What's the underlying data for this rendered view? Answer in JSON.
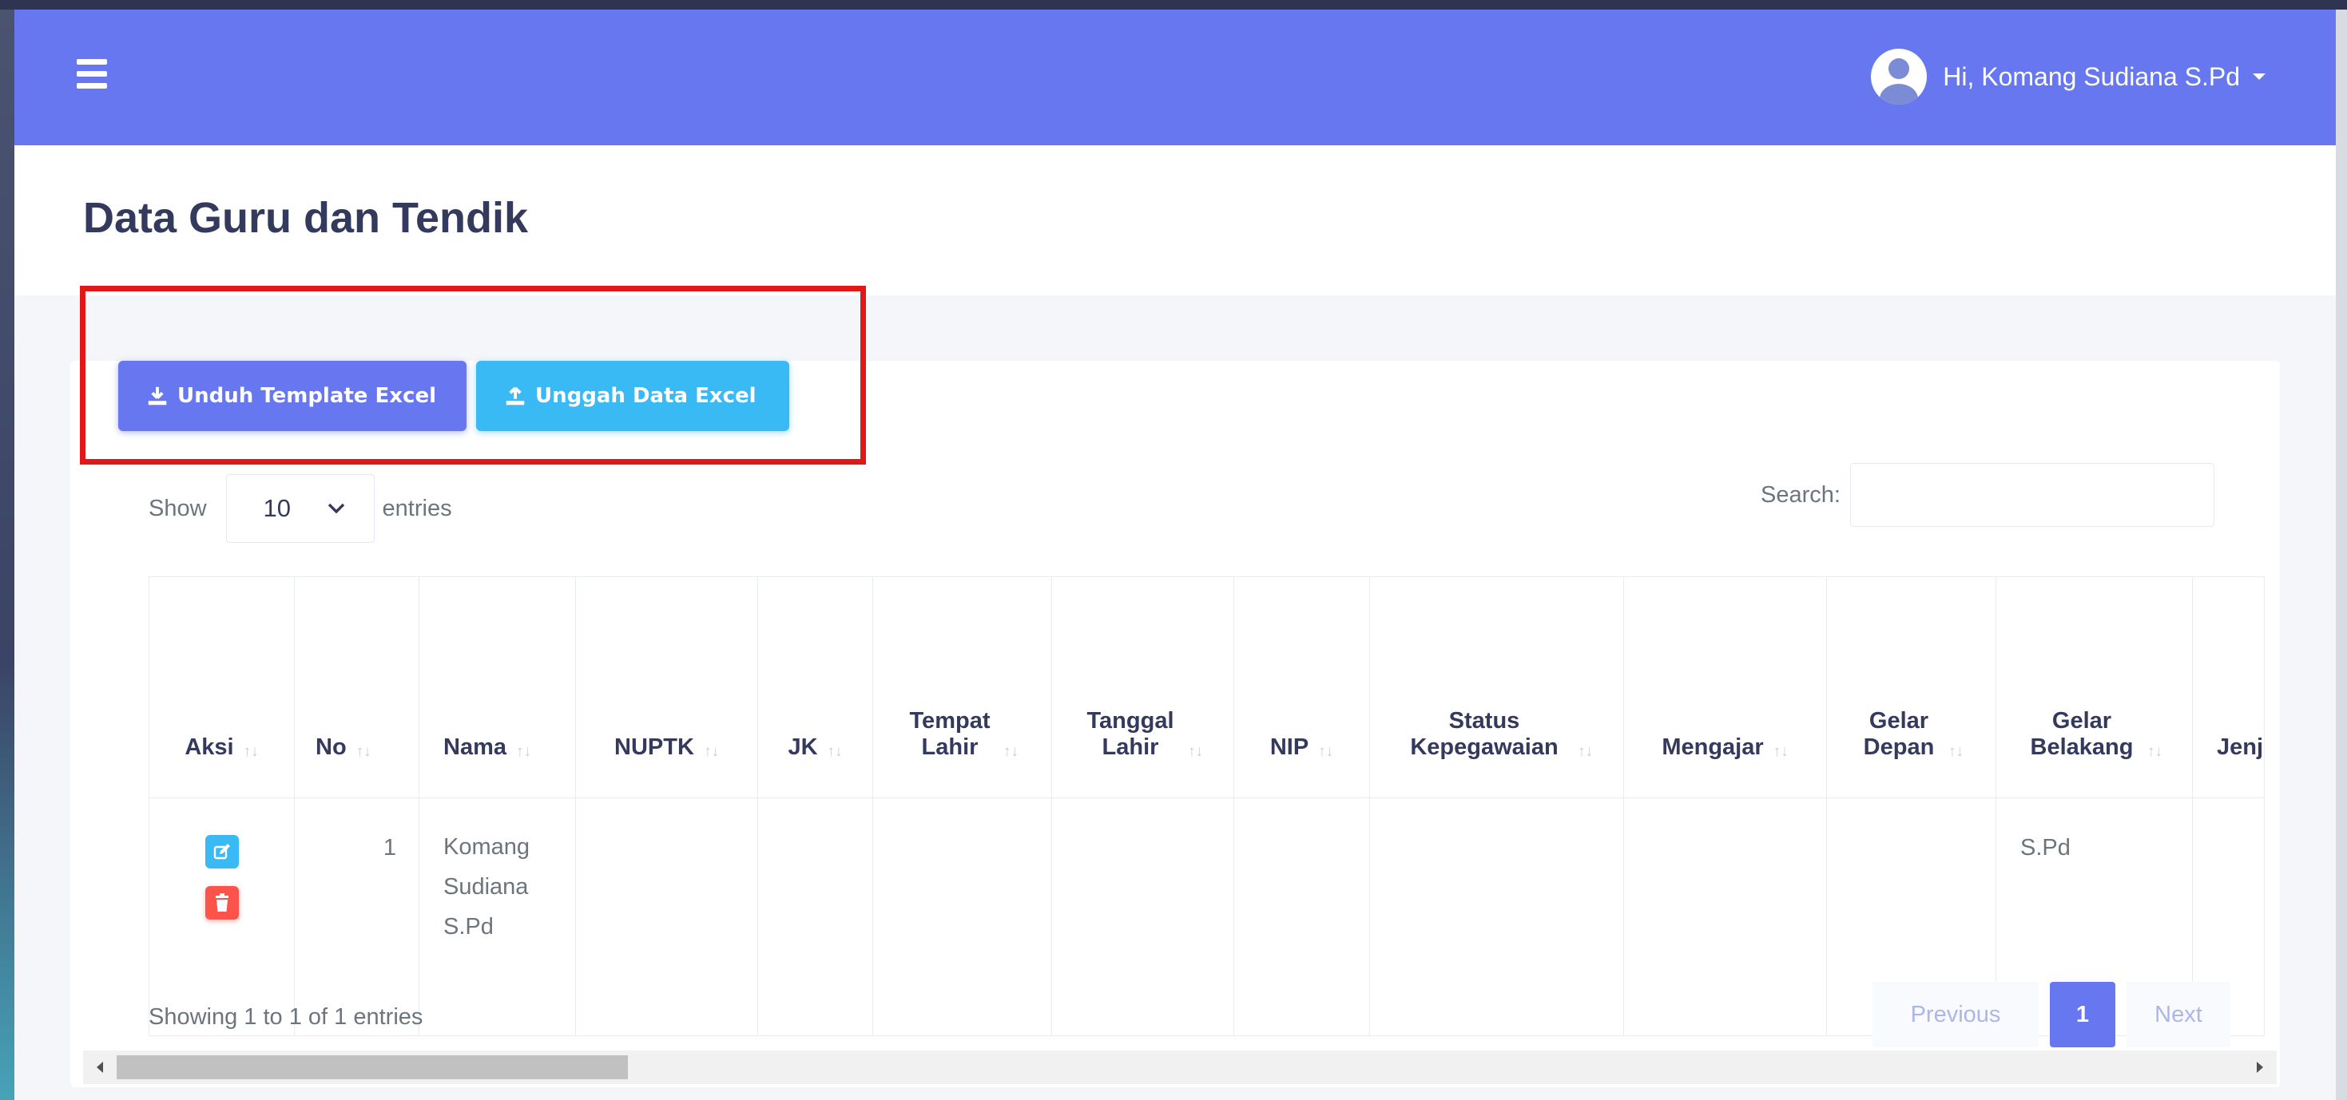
{
  "topbar": {
    "user_greeting": "Hi, Komang Sudiana S.Pd"
  },
  "page": {
    "title": "Data Guru dan Tendik"
  },
  "buttons": {
    "download_label": "Unduh Template Excel",
    "upload_label": "Unggah Data Excel"
  },
  "table_controls": {
    "show_label": "Show",
    "entries_value": "10",
    "entries_label": "entries",
    "search_label": "Search:",
    "search_value": ""
  },
  "table": {
    "columns": [
      "Aksi",
      "No",
      "Nama",
      "NUPTK",
      "JK",
      "Tempat Lahir",
      "Tanggal Lahir",
      "NIP",
      "Status Kepegawaian",
      "Mengajar",
      "Gelar Depan",
      "Gelar Belakang",
      "Jenj"
    ],
    "rows": [
      {
        "no": "1",
        "nama": "Komang Sudiana S.Pd",
        "nuptk": "",
        "jk": "",
        "tempat_lahir": "",
        "tanggal_lahir": "",
        "nip": "",
        "status_kepegawaian": "",
        "mengajar": "",
        "gelar_depan": "",
        "gelar_belakang": "S.Pd"
      }
    ]
  },
  "footer": {
    "showing_text": "Showing 1 to 1 of 1 entries",
    "prev_label": "Previous",
    "page_number": "1",
    "next_label": "Next"
  },
  "icons": [
    "hamburger-menu-icon",
    "user-avatar-icon",
    "download-icon",
    "upload-icon",
    "edit-icon",
    "trash-icon",
    "sort-icon"
  ],
  "colors": {
    "primary": "#6777ef",
    "info": "#3abaf4",
    "danger": "#fc544b",
    "highlight": "#e01818"
  }
}
